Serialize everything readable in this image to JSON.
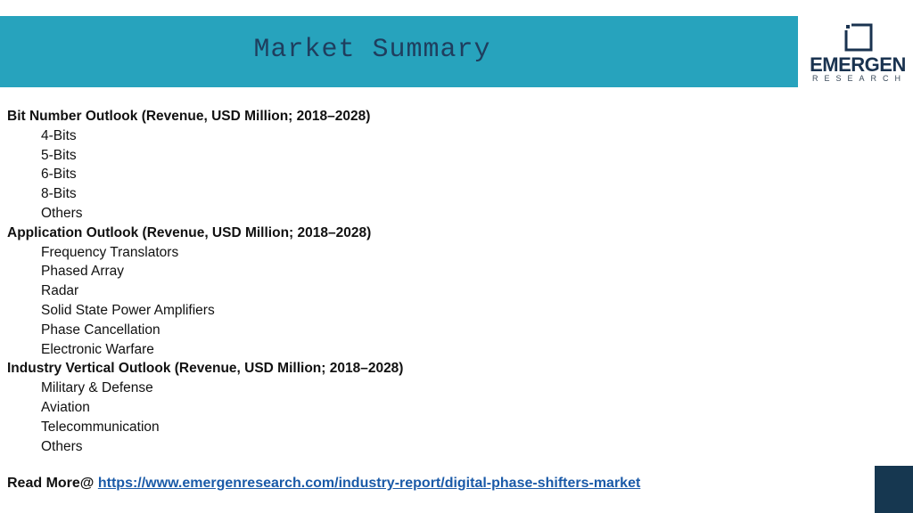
{
  "header": {
    "title": "Market Summary"
  },
  "logo": {
    "name": "EMERGEN",
    "subtitle": "RESEARCH",
    "icon": "square-bracket-logo-icon"
  },
  "sections": [
    {
      "heading": "Bit Number Outlook (Revenue, USD Million; 2018–2028)",
      "items": [
        "4-Bits",
        "5-Bits",
        "6-Bits",
        "8-Bits",
        "Others"
      ]
    },
    {
      "heading": "Application Outlook (Revenue, USD Million; 2018–2028)",
      "items": [
        "Frequency Translators",
        "Phased Array",
        "Radar",
        "Solid State Power Amplifiers",
        "Phase Cancellation",
        "Electronic Warfare"
      ]
    },
    {
      "heading": "Industry Vertical Outlook (Revenue, USD Million; 2018–2028)",
      "items": [
        "Military & Defense",
        "Aviation",
        "Telecommunication",
        "Others"
      ]
    }
  ],
  "footer": {
    "label": "Read More@",
    "link_text": "https://www.emergenresearch.com/industry-report/digital-phase-shifters-market"
  },
  "colors": {
    "header_band": "#27a3bd",
    "title_text": "#1f3e5e",
    "logo_text": "#1a3350",
    "link": "#1a5aa8",
    "corner_block": "#163750"
  }
}
